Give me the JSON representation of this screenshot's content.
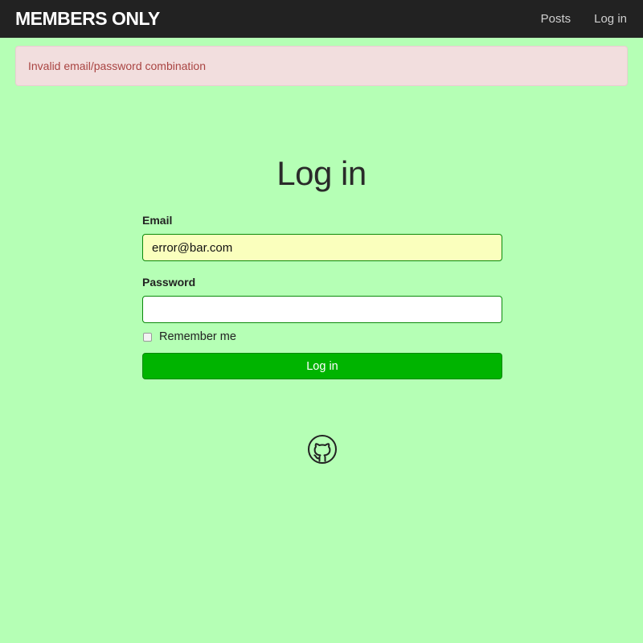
{
  "navbar": {
    "brand": "MEMBERS ONLY",
    "links": [
      "Posts",
      "Log in"
    ]
  },
  "alert": {
    "message": "Invalid email/password combination"
  },
  "page": {
    "title": "Log in"
  },
  "form": {
    "email_label": "Email",
    "email_value": "error@bar.com",
    "password_label": "Password",
    "password_value": "",
    "remember_label": "Remember me",
    "remember_checked": false,
    "submit_label": "Log in"
  },
  "footer": {
    "icon": "github-icon"
  },
  "colors": {
    "background": "#b5ffb5",
    "navbar": "#222222",
    "alert_bg": "#f2dede",
    "alert_text": "#a94442",
    "button": "#00b400",
    "autofill": "#faffbd"
  }
}
